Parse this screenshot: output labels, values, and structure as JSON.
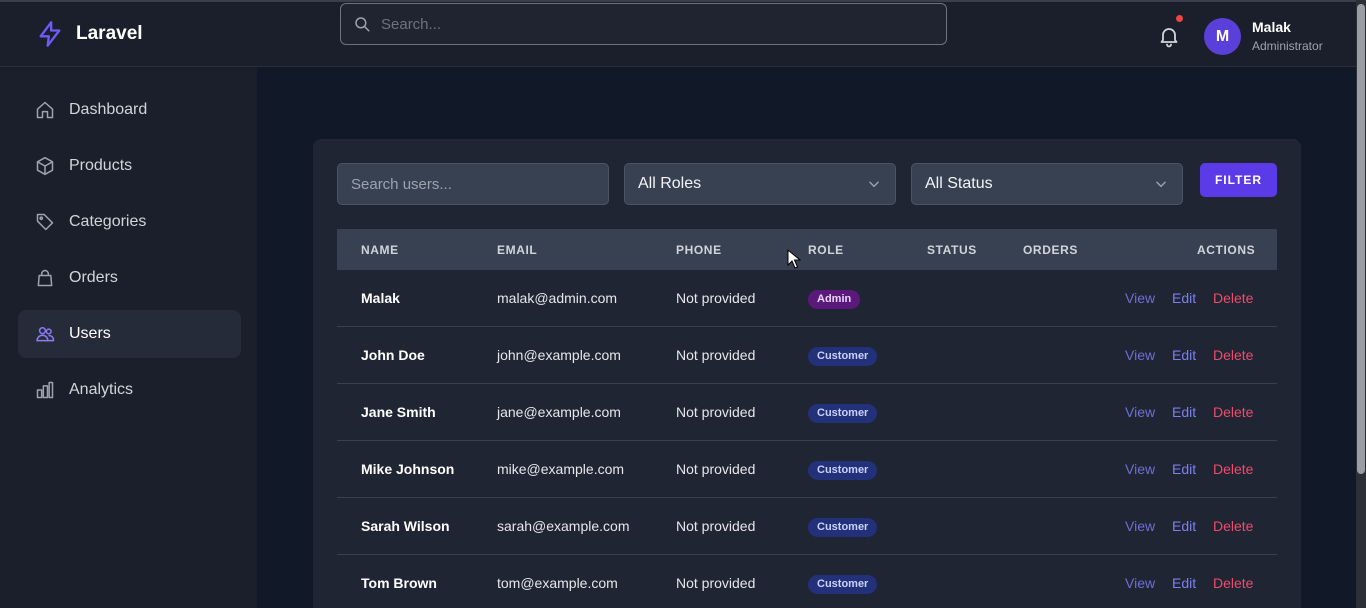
{
  "brand": {
    "name": "Laravel",
    "icon": "bolt-icon"
  },
  "search": {
    "placeholder": "Search..."
  },
  "user": {
    "initial": "M",
    "name": "Malak",
    "role": "Administrator"
  },
  "sidebar": {
    "items": [
      {
        "label": "Dashboard",
        "icon": "home-icon"
      },
      {
        "label": "Products",
        "icon": "cube-icon"
      },
      {
        "label": "Categories",
        "icon": "tag-icon"
      },
      {
        "label": "Orders",
        "icon": "shopping-bag-icon"
      },
      {
        "label": "Users",
        "icon": "users-icon",
        "active": true
      },
      {
        "label": "Analytics",
        "icon": "chart-bar-icon"
      }
    ]
  },
  "filters": {
    "search_placeholder": "Search users...",
    "role_value": "All Roles",
    "status_value": "All Status",
    "button_label": "FILTER"
  },
  "table": {
    "headers": {
      "name": "NAME",
      "email": "EMAIL",
      "phone": "PHONE",
      "role": "ROLE",
      "status": "STATUS",
      "orders": "ORDERS",
      "actions": "ACTIONS"
    },
    "actions": {
      "view": "View",
      "edit": "Edit",
      "delete": "Delete"
    },
    "rows": [
      {
        "name": "Malak",
        "email": "malak@admin.com",
        "phone": "Not provided",
        "role": "Admin"
      },
      {
        "name": "John Doe",
        "email": "john@example.com",
        "phone": "Not provided",
        "role": "Customer"
      },
      {
        "name": "Jane Smith",
        "email": "jane@example.com",
        "phone": "Not provided",
        "role": "Customer"
      },
      {
        "name": "Mike Johnson",
        "email": "mike@example.com",
        "phone": "Not provided",
        "role": "Customer"
      },
      {
        "name": "Sarah Wilson",
        "email": "sarah@example.com",
        "phone": "Not provided",
        "role": "Customer"
      },
      {
        "name": "Tom Brown",
        "email": "tom@example.com",
        "phone": "Not provided",
        "role": "Customer"
      }
    ]
  },
  "colors": {
    "accent": "#5b3be8",
    "admin_badge": "#5b1a7a",
    "customer_badge": "#23307a",
    "delete": "#f04b6a",
    "notification_dot": "#ef4444"
  }
}
